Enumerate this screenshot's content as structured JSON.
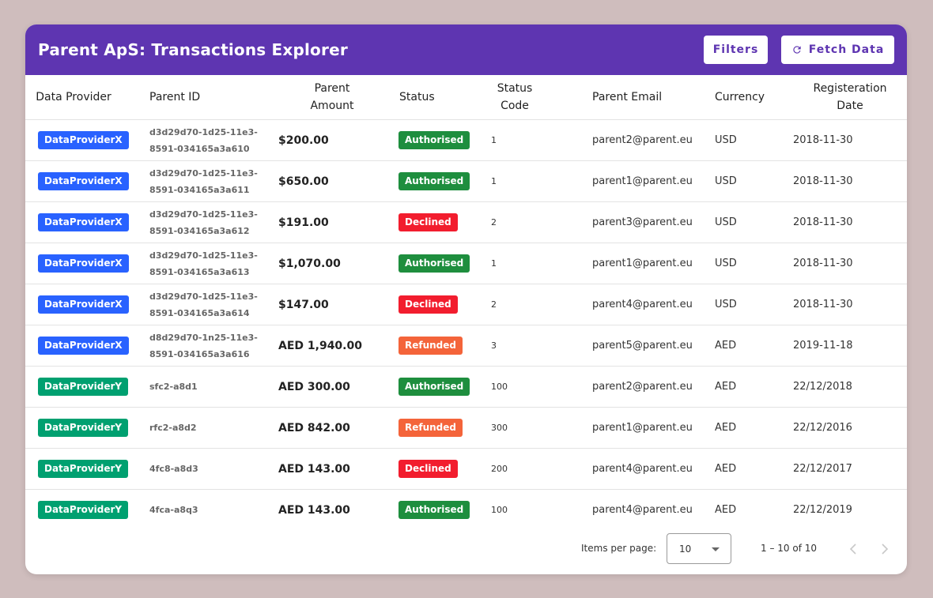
{
  "header": {
    "title": "Parent ApS: Transactions Explorer",
    "filters_label": "Filters",
    "fetch_label": "Fetch Data"
  },
  "columns": [
    "Data Provider",
    "Parent ID",
    "Parent Amount",
    "Status",
    "Status Code",
    "Parent Email",
    "Currency",
    "Registeration Date"
  ],
  "colors": {
    "header_bg": "#5e35b1",
    "provider_x": "#2962ff",
    "provider_y": "#00a070",
    "authorised": "#1e8e3e",
    "declined": "#f21d2e",
    "refunded": "#f4643a"
  },
  "rows": [
    {
      "provider": "DataProviderX",
      "id_line1": "d3d29d70-1d25-11e3-",
      "id_line2": "8591-034165a3a610",
      "amount": "$200.00",
      "status": "Authorised",
      "code": "1",
      "email": "parent2@parent.eu",
      "currency": "USD",
      "date": "2018-11-30"
    },
    {
      "provider": "DataProviderX",
      "id_line1": "d3d29d70-1d25-11e3-",
      "id_line2": "8591-034165a3a611",
      "amount": "$650.00",
      "status": "Authorised",
      "code": "1",
      "email": "parent1@parent.eu",
      "currency": "USD",
      "date": "2018-11-30"
    },
    {
      "provider": "DataProviderX",
      "id_line1": "d3d29d70-1d25-11e3-",
      "id_line2": "8591-034165a3a612",
      "amount": "$191.00",
      "status": "Declined",
      "code": "2",
      "email": "parent3@parent.eu",
      "currency": "USD",
      "date": "2018-11-30"
    },
    {
      "provider": "DataProviderX",
      "id_line1": "d3d29d70-1d25-11e3-",
      "id_line2": "8591-034165a3a613",
      "amount": "$1,070.00",
      "status": "Authorised",
      "code": "1",
      "email": "parent1@parent.eu",
      "currency": "USD",
      "date": "2018-11-30"
    },
    {
      "provider": "DataProviderX",
      "id_line1": "d3d29d70-1d25-11e3-",
      "id_line2": "8591-034165a3a614",
      "amount": "$147.00",
      "status": "Declined",
      "code": "2",
      "email": "parent4@parent.eu",
      "currency": "USD",
      "date": "2018-11-30"
    },
    {
      "provider": "DataProviderX",
      "id_line1": "d8d29d70-1n25-11e3-",
      "id_line2": "8591-034165a3a616",
      "amount": "AED 1,940.00",
      "status": "Refunded",
      "code": "3",
      "email": "parent5@parent.eu",
      "currency": "AED",
      "date": "2019-11-18"
    },
    {
      "provider": "DataProviderY",
      "id_line1": "sfc2-a8d1",
      "id_line2": "",
      "amount": "AED 300.00",
      "status": "Authorised",
      "code": "100",
      "email": "parent2@parent.eu",
      "currency": "AED",
      "date": "22/12/2018"
    },
    {
      "provider": "DataProviderY",
      "id_line1": "rfc2-a8d2",
      "id_line2": "",
      "amount": "AED 842.00",
      "status": "Refunded",
      "code": "300",
      "email": "parent1@parent.eu",
      "currency": "AED",
      "date": "22/12/2016"
    },
    {
      "provider": "DataProviderY",
      "id_line1": "4fc8-a8d3",
      "id_line2": "",
      "amount": "AED 143.00",
      "status": "Declined",
      "code": "200",
      "email": "parent4@parent.eu",
      "currency": "AED",
      "date": "22/12/2017"
    },
    {
      "provider": "DataProviderY",
      "id_line1": "4fca-a8q3",
      "id_line2": "",
      "amount": "AED 143.00",
      "status": "Authorised",
      "code": "100",
      "email": "parent4@parent.eu",
      "currency": "AED",
      "date": "22/12/2019"
    }
  ],
  "pager": {
    "items_per_page_label": "Items per page:",
    "items_per_page_value": "10",
    "range_label": "1 – 10 of 10"
  }
}
